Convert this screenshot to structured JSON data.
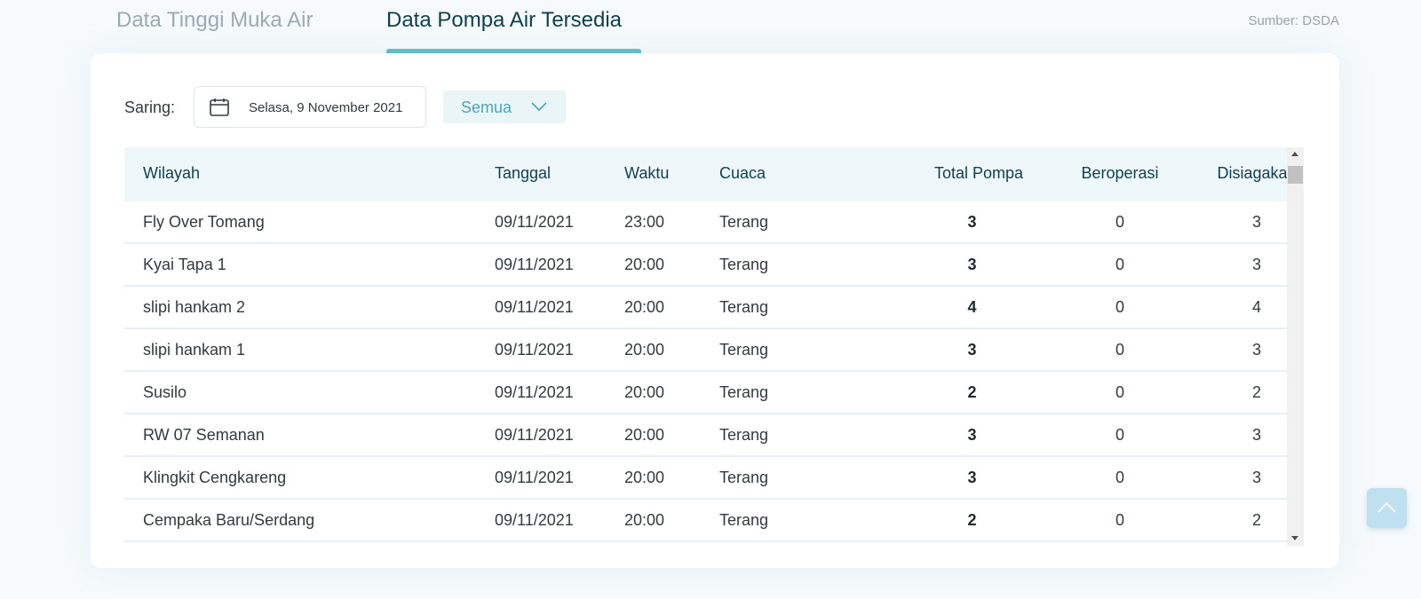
{
  "tabs": [
    {
      "label": "Data Tinggi Muka Air",
      "active": false
    },
    {
      "label": "Data Pompa Air Tersedia",
      "active": true
    }
  ],
  "source": "Sumber: DSDA",
  "filter": {
    "label": "Saring:",
    "date": "Selasa, 9 November 2021",
    "date_icon": "calendar-icon",
    "select_value": "Semua",
    "select_icon": "chevron-down-icon"
  },
  "table": {
    "headers": [
      "Wilayah",
      "Tanggal",
      "Waktu",
      "Cuaca",
      "Total Pompa",
      "Beroperasi",
      "Disiagakan"
    ],
    "rows": [
      [
        "Fly Over Tomang",
        "09/11/2021",
        "23:00",
        "Terang",
        "3",
        "0",
        "3"
      ],
      [
        "Kyai Tapa 1",
        "09/11/2021",
        "20:00",
        "Terang",
        "3",
        "0",
        "3"
      ],
      [
        "slipi hankam 2",
        "09/11/2021",
        "20:00",
        "Terang",
        "4",
        "0",
        "4"
      ],
      [
        "slipi hankam 1",
        "09/11/2021",
        "20:00",
        "Terang",
        "3",
        "0",
        "3"
      ],
      [
        "Susilo",
        "09/11/2021",
        "20:00",
        "Terang",
        "2",
        "0",
        "2"
      ],
      [
        "RW 07 Semanan",
        "09/11/2021",
        "20:00",
        "Terang",
        "3",
        "0",
        "3"
      ],
      [
        "Klingkit Cengkareng",
        "09/11/2021",
        "20:00",
        "Terang",
        "3",
        "0",
        "3"
      ],
      [
        "Cempaka Baru/Serdang",
        "09/11/2021",
        "20:00",
        "Terang",
        "2",
        "0",
        "2"
      ]
    ]
  },
  "back_to_top_icon": "chevron-up-icon",
  "colors": {
    "accent": "#5bbcc8",
    "heading": "#0f3f4c",
    "inactive_tab": "#9aacb2",
    "header_bg": "#eef7fa",
    "select_bg": "#eaf5f8",
    "select_text": "#4aa6b7"
  }
}
